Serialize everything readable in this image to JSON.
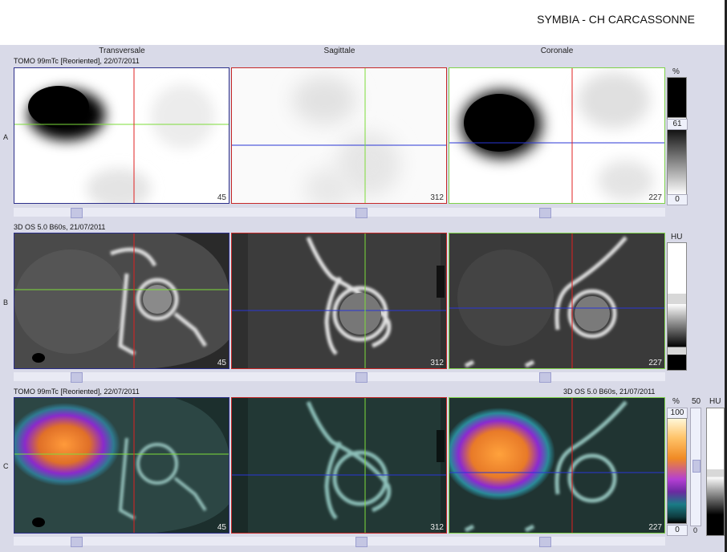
{
  "header": {
    "institution": "SYMBIA - CH CARCASSONNE"
  },
  "columns": {
    "transverse": "Transversale",
    "sagittal": "Sagittale",
    "coronal": "Coronale"
  },
  "rows": {
    "a": {
      "label": "A",
      "info": "TOMO 99mTc [Reoriented], 22/07/2011"
    },
    "b": {
      "label": "B",
      "info": "3D  OS  5.0  B60s, 21/07/2011"
    },
    "c": {
      "label": "C",
      "info_left": "TOMO 99mTc [Reoriented], 22/07/2011",
      "info_right": "3D  OS  5.0  B60s, 21/07/2011"
    }
  },
  "slices": {
    "transverse": "45",
    "sagittal": "312",
    "coronal": "227"
  },
  "colorbars": {
    "a": {
      "unit": "%",
      "mid": "61",
      "low": "0"
    },
    "b": {
      "unit": "HU"
    },
    "c": {
      "unit": "%",
      "top": "100",
      "low": "0",
      "blend_top": "50",
      "blend_low": "0",
      "unit2": "HU"
    }
  },
  "colors": {
    "transverse_border": "#2c2f8a",
    "sagittal_border": "#c62828",
    "coronal_border": "#7fd34a",
    "crosshair_red": "#e02020",
    "crosshair_green": "#7ddc3a",
    "crosshair_blue": "#2a36d6"
  }
}
